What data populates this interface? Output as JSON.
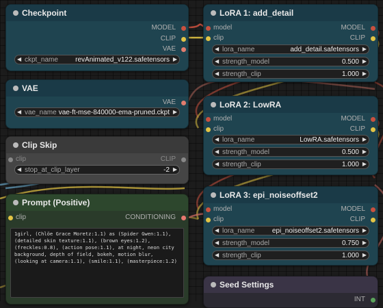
{
  "colors": {
    "model": "#c9513f",
    "clip": "#e3c445",
    "vae": "#e27d6e",
    "conditioning": "#e87870",
    "int": "#5ba45b"
  },
  "checkpoint": {
    "title": "Checkpoint",
    "outputs": [
      "MODEL",
      "CLIP",
      "VAE"
    ],
    "widget": {
      "label": "ckpt_name",
      "value": "revAnimated_v122.safetensors"
    }
  },
  "vae": {
    "title": "VAE",
    "outputs": [
      "VAE"
    ],
    "widget": {
      "label": "vae_name",
      "value": "vae-ft-mse-840000-ema-pruned.ckpt"
    }
  },
  "clip_skip": {
    "title": "Clip Skip",
    "input": "clip",
    "output": "CLIP",
    "widget": {
      "label": "stop_at_clip_layer",
      "value": "-2"
    }
  },
  "prompt": {
    "title": "Prompt (Positive)",
    "input": "clip",
    "output": "CONDITIONING",
    "text": "1girl, (Chlöe Grace Moretz:1.1) as (Spider Gwen:1.1), (detailed skin texture:1.1), (brown eyes:1.2), (freckles:0.8), (action pose:1.1), at night, neon city background, depth of field, bokeh, motion blur, (looking at camera:1.1), (smile:1.1), (masterpiece:1.2)"
  },
  "lora1": {
    "title": "LoRA 1: add_detail",
    "inputs": [
      "model",
      "clip"
    ],
    "outputs": [
      "MODEL",
      "CLIP"
    ],
    "widgets": [
      {
        "label": "lora_name",
        "value": "add_detail.safetensors"
      },
      {
        "label": "strength_model",
        "value": "0.500"
      },
      {
        "label": "strength_clip",
        "value": "1.000"
      }
    ]
  },
  "lora2": {
    "title": "LoRA 2: LowRA",
    "inputs": [
      "model",
      "clip"
    ],
    "outputs": [
      "MODEL",
      "CLIP"
    ],
    "widgets": [
      {
        "label": "lora_name",
        "value": "LowRA.safetensors"
      },
      {
        "label": "strength_model",
        "value": "0.500"
      },
      {
        "label": "strength_clip",
        "value": "1.000"
      }
    ]
  },
  "lora3": {
    "title": "LoRA 3: epi_noiseoffset2",
    "inputs": [
      "model",
      "clip"
    ],
    "outputs": [
      "MODEL",
      "CLIP"
    ],
    "widgets": [
      {
        "label": "lora_name",
        "value": "epi_noiseoffset2.safetensors"
      },
      {
        "label": "strength_model",
        "value": "0.750"
      },
      {
        "label": "strength_clip",
        "value": "1.000"
      }
    ]
  },
  "seed": {
    "title": "Seed Settings",
    "output": "INT"
  }
}
